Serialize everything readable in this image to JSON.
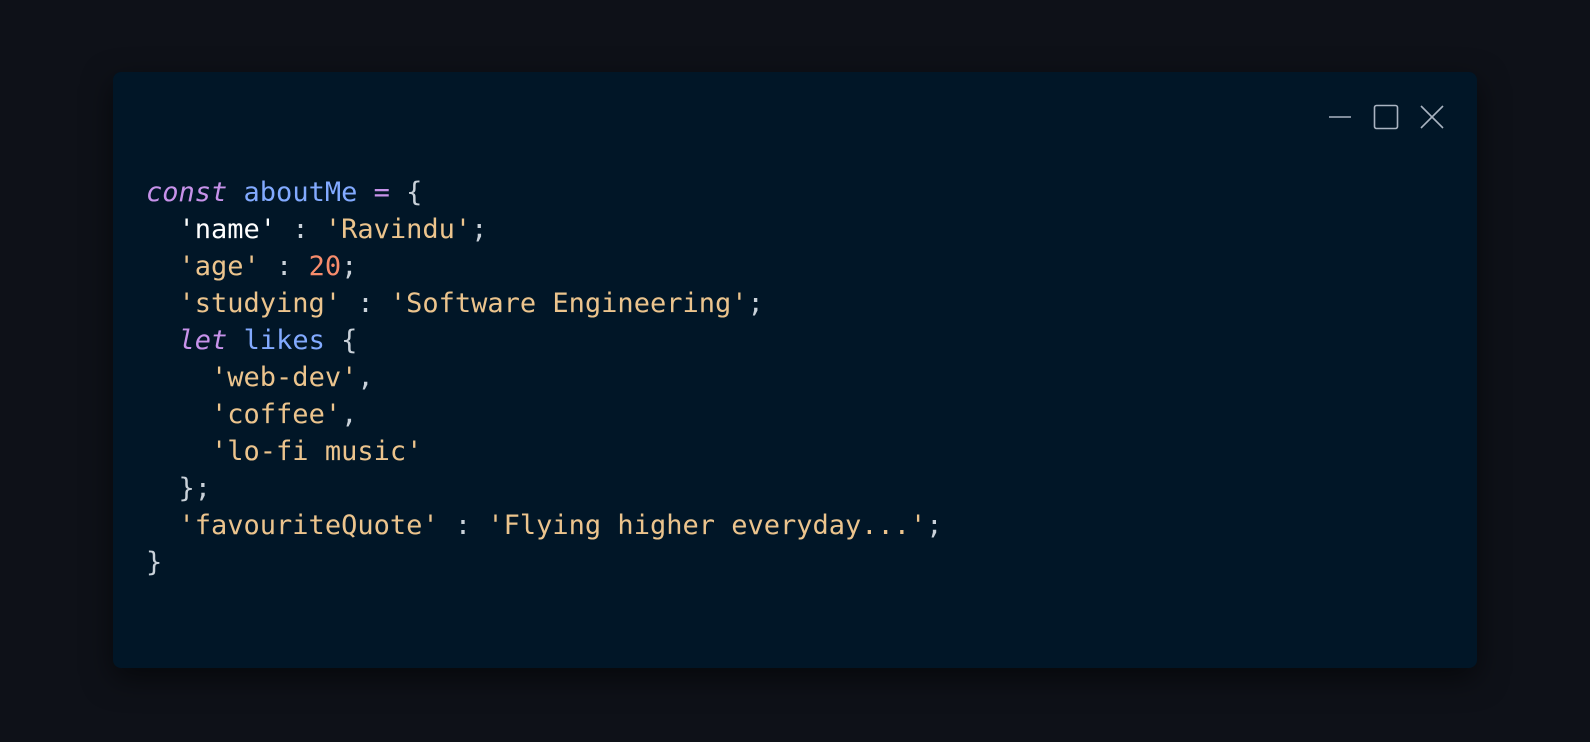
{
  "window": {
    "controls": {
      "minimize_icon": "minimize-icon",
      "maximize_icon": "maximize-icon",
      "close_icon": "close-icon"
    }
  },
  "colors": {
    "background": "#0e1118",
    "panel": "#011627",
    "keyword": "#c792ea",
    "identifier": "#82aaff",
    "string": "#ecc48d",
    "number": "#f78c6c",
    "punctuation": "#c9d1d9"
  },
  "code": {
    "line1": {
      "keyword": "const",
      "name": "aboutMe",
      "op": "=",
      "open": "{"
    },
    "line2": {
      "key": "'name'",
      "sep": " : ",
      "value": "'Ravindu'",
      "end": ";"
    },
    "line3": {
      "key": "'age'",
      "sep": " : ",
      "value": "20",
      "end": ";"
    },
    "line4": {
      "key": "'studying'",
      "sep": " : ",
      "value": "'Software Engineering'",
      "end": ";"
    },
    "line5": {
      "keyword": "let",
      "name": "likes",
      "open": "{"
    },
    "likes": [
      {
        "value": "'web-dev'",
        "end": ","
      },
      {
        "value": "'coffee'",
        "end": ","
      },
      {
        "value": "'lo-fi music'",
        "end": ""
      }
    ],
    "line9": {
      "close": "};"
    },
    "line10": {
      "key": "'favouriteQuote'",
      "sep": " : ",
      "value": "'Flying higher everyday...'",
      "end": ";"
    },
    "line11": {
      "close": "}"
    }
  }
}
